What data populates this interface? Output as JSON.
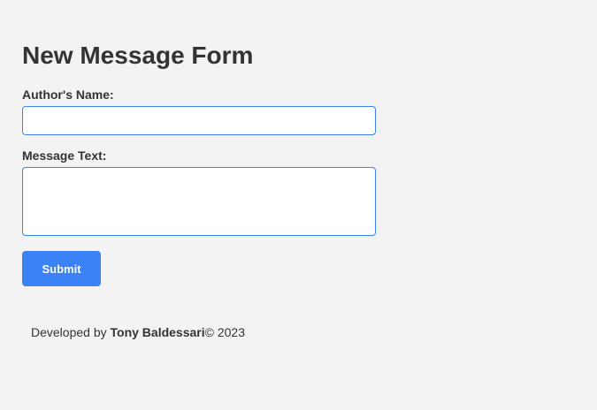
{
  "form": {
    "title": "New Message Form",
    "author_label": "Author's Name:",
    "author_value": "",
    "message_label": "Message Text:",
    "message_value": "",
    "submit_label": "Submit"
  },
  "footer": {
    "prefix": "Developed by ",
    "author_name": "Tony Baldessari",
    "suffix": "© 2023"
  },
  "colors": {
    "background": "#f3f3f3",
    "accent": "#3b82f6",
    "text": "#333333"
  }
}
